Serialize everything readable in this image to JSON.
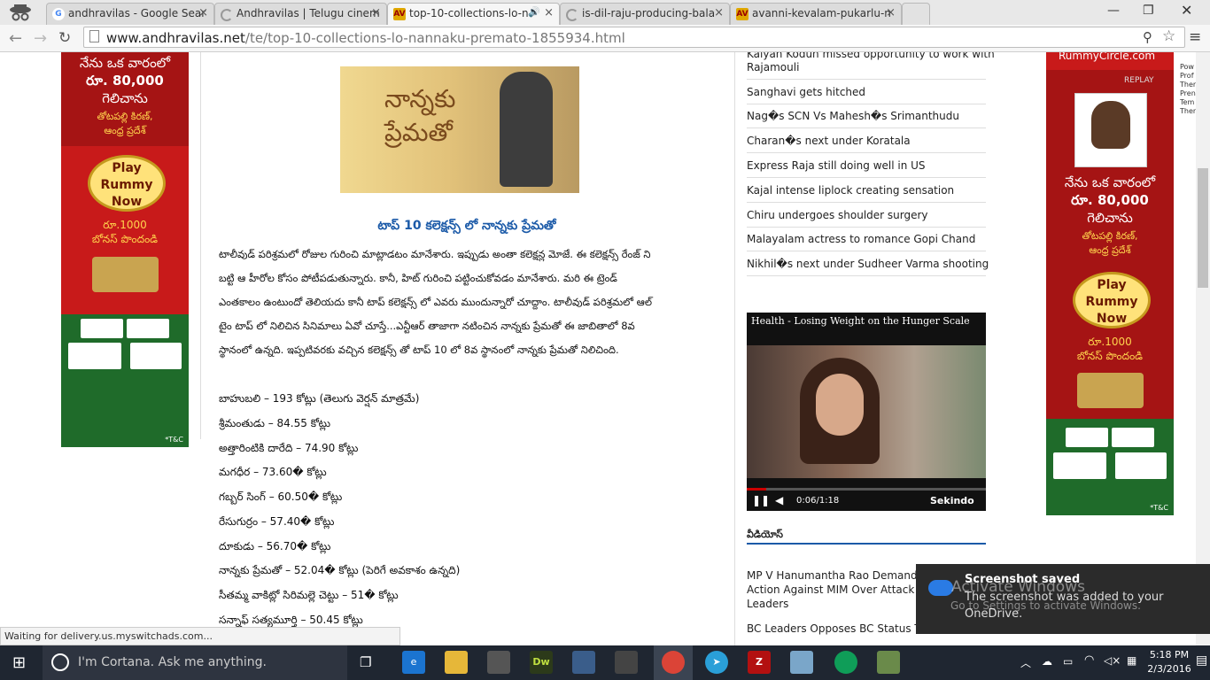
{
  "browser": {
    "tabs": [
      {
        "label": "andhravilas - Google Sear",
        "favicon": "G"
      },
      {
        "label": "Andhravilas | Telugu cinem",
        "favicon": "loading"
      },
      {
        "label": "top-10-collections-lo-n",
        "favicon": "AV",
        "active": true
      },
      {
        "label": "is-dil-raju-producing-bala",
        "favicon": "loading"
      },
      {
        "label": "avanni-kevalam-pukarlu-n",
        "favicon": "AV"
      }
    ],
    "url_prefix": "www.andhravilas.net",
    "url_path": "/te/top-10-collections-lo-nannaku-premato-1855934.html",
    "status": "Waiting for delivery.us.myswitchads.com..."
  },
  "ad_left": {
    "line1": "నేను ఒక వారంలో",
    "line2": "రూ. 80,000",
    "line3": "గెలిచాను",
    "name": "తోటపల్లి కిరణ్,",
    "place": "ఆంధ్ర ప్రదేశ్",
    "play1": "Play",
    "play2": "Rummy",
    "play3": "Now",
    "bonus1": "రూ.1000",
    "bonus2": "బోనస్ పొందండి",
    "tc": "*T&C"
  },
  "ad_right": {
    "brand": "RummyCircle.com",
    "replay": "REPLAY",
    "line1": "నేను ఒక వారంలో",
    "line2": "రూ. 80,000",
    "line3": "గెలిచాను",
    "name": "తోటపల్లి కిరణ్,",
    "place": "ఆంధ్ర ప్రదేశ్",
    "play1": "Play",
    "play2": "Rummy",
    "play3": "Now",
    "bonus1": "రూ.1000",
    "bonus2": "బోనస్ పొందండి",
    "tc": "*T&C"
  },
  "article": {
    "image_text": "నాన్నకు ప్రేమతో",
    "title": "టాప్ 10 కలెక్షన్స్ లో నాన్నకు ప్రేమతో",
    "paragraph": [
      "టాలీవుడ్ పరిశ్రమలో రోజుల గురించి మాట్లాడటం మానేశారు. ఇప్పుడు అంతా కలెక్షన్ల మోజే. ఈ కలెక్షన్స్ రేంజ్ ని",
      "బట్టి ఆ హీరోల కోసం పోటీపడుతున్నారు. కానీ, హిట్ గురించి పట్టించుకోవడం మానేశారు. మరి ఈ ట్రెండ్",
      "ఎంతకాలం ఉంటుందో తెలియదు కానీ టాప్ కలెక్షన్స్ లో ఎవరు ముందున్నారో చూద్దాం. టాలీవుడ్ పరిశ్రమలో ఆల్",
      "టైం టాప్ లో నిలిచిన సినిమాలు ఏవో చూస్తే...ఎన్టీఆర్ తాజాగా నటించిన నాన్నకు ప్రేమతో ఈ జాబితాలో 8వ",
      "స్థానంలో ఉన్నది. ఇప్పటివరకు వచ్చిన కలెక్షన్స్ తో టాప్ 10 లో 8వ స్థానంలో నాన్నకు ప్రేమతో నిలిచింది."
    ],
    "list": [
      "బాహుబలి – 193 కోట్లు (తెలుగు వెర్షన్ మాత్రమే)",
      "శ్రీమంతుడు – 84.55 కోట్లు",
      "అత్తారింటికి దారేది – 74.90 కోట్లు",
      "మగధీర – 73.60� కోట్లు",
      "గబ్బర్ సింగ్ – 60.50� కోట్లు",
      "రేసుగుర్రం – 57.40� కోట్లు",
      "దూకుడు – 56.70� కోట్లు",
      "నాన్నకు ప్రేమతో – 52.04� కోట్లు (పెరిగే అవకాశం ఉన్నది)",
      "సీతమ్మ వాకిట్లో సిరిమల్లె చెట్టు – 51� కోట్లు",
      "సన్నాఫ్ సత్యమూర్తి – 50.45 కోట్లు"
    ]
  },
  "sidebar": {
    "top_partial": "Kalyan Kodun missed opportunity to work with",
    "top_partial2": "Rajamouli",
    "items": [
      "Sanghavi gets hitched",
      "Nag�s SCN Vs Mahesh�s Srimanthudu",
      "Charan�s next under Koratala",
      "Express Raja still doing well in US",
      "Kajal intense liplock creating sensation",
      "Chiru undergoes shoulder surgery",
      "Malayalam actress to romance Gopi Chand",
      "Nikhil�s next under Sudheer Varma shooting"
    ],
    "video_title": "Health - Losing Weight on the Hunger Scale",
    "video_time": "0:06/1:18",
    "video_brand": "Sekindo",
    "videos_heading": "వీడియోస్",
    "news1a": "MP V Hanumantha Rao Demands CM",
    "news1b": "Action Against MIM Over Attack On C",
    "news1c": "Leaders",
    "news2": "BC Leaders Opposes BC Status To Ka"
  },
  "right_edge_text": [
    "Pow",
    "Prof",
    "Ther",
    "Pren",
    "Tem",
    "Ther"
  ],
  "notification": {
    "title": "Screenshot saved",
    "body1": "The screenshot was added to your",
    "body2": "OneDrive.",
    "watermark1": "Activate Windows",
    "watermark2": "Go to Settings to activate Windows."
  },
  "taskbar": {
    "cortana": "I'm Cortana. Ask me anything.",
    "time": "5:18 PM",
    "date": "2/3/2016"
  }
}
